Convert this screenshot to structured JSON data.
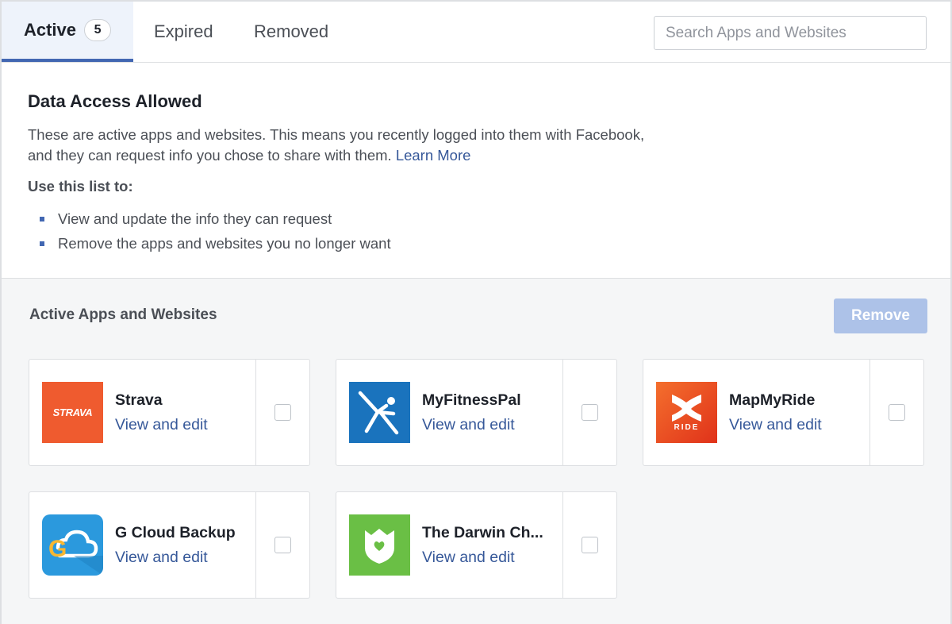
{
  "tabs": {
    "active_label": "Active",
    "active_count": "5",
    "expired_label": "Expired",
    "removed_label": "Removed"
  },
  "search": {
    "placeholder": "Search Apps and Websites"
  },
  "info": {
    "title": "Data Access Allowed",
    "description": "These are active apps and websites. This means you recently logged into them with Facebook, and they can request info you chose to share with them.",
    "learn_more": "Learn More",
    "use_title": "Use this list to:",
    "bullets": [
      "View and update the info they can request",
      "Remove the apps and websites you no longer want"
    ]
  },
  "apps": {
    "title": "Active Apps and Websites",
    "remove_label": "Remove",
    "items": [
      {
        "name": "Strava",
        "action": "View and edit",
        "logo_text": "STRAVA",
        "icon": "strava-logo-icon",
        "color": "#ef5b2f"
      },
      {
        "name": "MyFitnessPal",
        "action": "View and edit",
        "icon": "myfitnesspal-logo-icon",
        "color": "#1a73bd"
      },
      {
        "name": "MapMyRide",
        "action": "View and edit",
        "logo_text": "RIDE",
        "icon": "mapmyride-logo-icon",
        "color": "#e8431f"
      },
      {
        "name": "G Cloud Backup",
        "action": "View and edit",
        "logo_text": "G",
        "icon": "gcloud-logo-icon",
        "color": "#2b99dd"
      },
      {
        "name": "The Darwin Ch...",
        "action": "View and edit",
        "icon": "darwin-logo-icon",
        "color": "#6abf45"
      }
    ]
  },
  "colors": {
    "accent": "#4267b2",
    "link": "#365899",
    "remove_button": "#adc2e8"
  }
}
